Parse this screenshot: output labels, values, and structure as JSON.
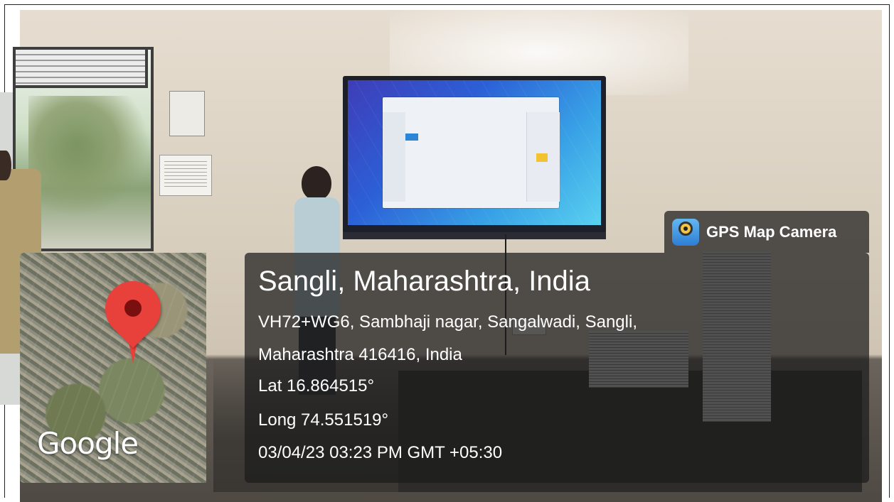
{
  "app_badge": {
    "label": "GPS Map Camera",
    "icon": "camera-lens-icon"
  },
  "map": {
    "provider_label": "Google",
    "pin_icon": "map-pin-icon",
    "pin_color": "#e8403b"
  },
  "location": {
    "title": "Sangli, Maharashtra, India",
    "address_line1": "VH72+WG6, Sambhaji nagar, Sangalwadi, Sangli,",
    "address_line2": "Maharashtra 416416, India",
    "latitude": "Lat 16.864515°",
    "longitude": "Long 74.551519°",
    "timestamp": "03/04/23 03:23 PM GMT +05:30"
  },
  "colors": {
    "overlay": "#1c1c1c",
    "text": "#ffffff"
  }
}
